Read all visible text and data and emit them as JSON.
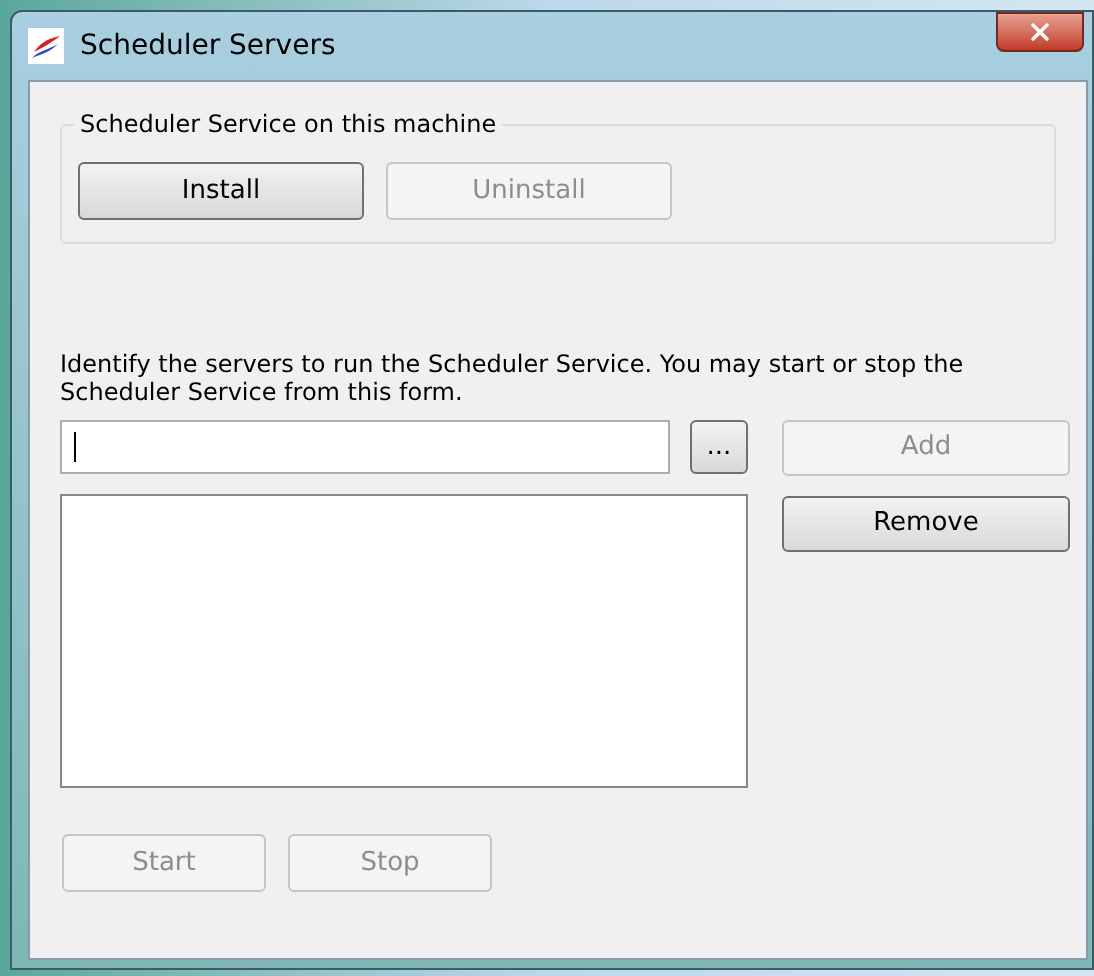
{
  "window": {
    "title": "Scheduler Servers"
  },
  "service_group": {
    "title": "Scheduler Service on this machine",
    "buttons": [
      {
        "label": "Install",
        "disabled": false
      },
      {
        "label": "Uninstall",
        "disabled": true
      }
    ]
  },
  "instructions": "Identify the servers to run the Scheduler Service. You may start or stop the Scheduler Service from this form.",
  "browse_button": {
    "label": "...",
    "disabled": false
  },
  "add_button": {
    "label": "Add",
    "disabled": true
  },
  "remove_button": {
    "label": "Remove",
    "disabled": false
  },
  "bottom_buttons": [
    {
      "label": "Start",
      "disabled": true
    },
    {
      "label": "Stop",
      "disabled": true
    }
  ]
}
